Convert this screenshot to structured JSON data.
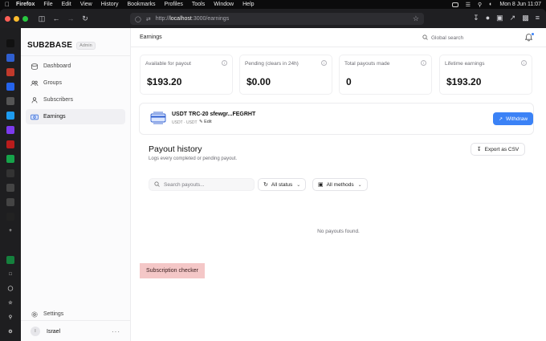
{
  "menubar": {
    "app": "Firefox",
    "items": [
      "File",
      "Edit",
      "View",
      "History",
      "Bookmarks",
      "Profiles",
      "Tools",
      "Window",
      "Help"
    ],
    "datetime": "Mon 8 Jun  11:07"
  },
  "browser": {
    "url_prefix": "http://",
    "url_host": "localhost",
    "url_rest": ":3000/earnings"
  },
  "sidebar": {
    "brand": "SUB2BASE",
    "badge": "Admin",
    "items": [
      {
        "label": "Dashboard"
      },
      {
        "label": "Groups"
      },
      {
        "label": "Subscribers"
      },
      {
        "label": "Earnings"
      }
    ],
    "settings": "Settings",
    "user": {
      "initial": "I",
      "name": "Israel",
      "more": "···"
    }
  },
  "header": {
    "title": "Earnings",
    "search_placeholder": "Global search"
  },
  "stats": [
    {
      "label": "Available for payout",
      "value": "$193.20"
    },
    {
      "label": "Pending (clears in 24h)",
      "value": "$0.00"
    },
    {
      "label": "Total payouts made",
      "value": "0"
    },
    {
      "label": "Lifetime earnings",
      "value": "$193.20"
    }
  ],
  "wallet": {
    "name": "USDT TRC-20 sfewgr...FEGRHT",
    "sub": "USDT · USDT",
    "edit": "Edit",
    "withdraw": "Withdraw"
  },
  "payouts": {
    "title": "Payout history",
    "subtitle": "Logs every completed or pending payout.",
    "export": "Export as CSV",
    "search_placeholder": "Search payouts...",
    "status_filter": "All status",
    "method_filter": "All methods",
    "empty": "No payouts found."
  },
  "checker": "Subscription checker",
  "colors": {
    "accent": "#3b82f6",
    "checker_bg": "#f4c7c7"
  }
}
